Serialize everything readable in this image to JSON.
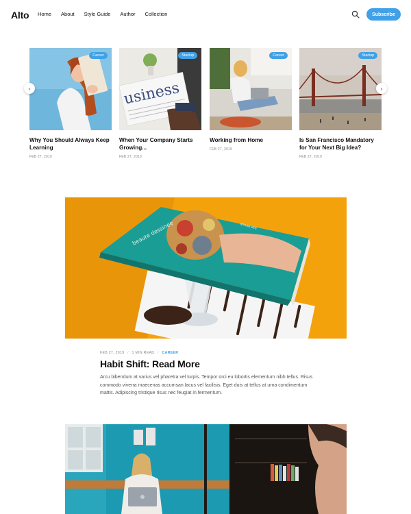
{
  "header": {
    "logo": "Alto",
    "nav": [
      "Home",
      "About",
      "Style Guide",
      "Author",
      "Collection"
    ],
    "search_icon": "search-icon",
    "subscribe_label": "Subscribe",
    "accent_color": "#3fa1e8"
  },
  "carousel": {
    "prev_icon": "chevron-left-icon",
    "next_icon": "chevron-right-icon",
    "cards": [
      {
        "tag": "Career",
        "title": "Why You Should Always Keep Learning",
        "date": "FEB 27, 2019"
      },
      {
        "tag": "Startup",
        "title": "When Your Company Starts Growing...",
        "date": "FEB 27, 2019"
      },
      {
        "tag": "Career",
        "title": "Working from Home",
        "date": "FEB 27, 2019"
      },
      {
        "tag": "Startup",
        "title": "Is San Francisco Mandatory for Your Next Big Idea?",
        "date": "FEB 27, 2019"
      }
    ]
  },
  "featured": {
    "date": "FEB 27, 2019",
    "read_time": "1 MIN READ",
    "category": "CAREER",
    "title": "Habit Shift: Read More",
    "excerpt": "Arcu bibendum at varius vel pharetra vel turpis. Tempor orci eu lobortis elementum nibh tellus. Risus commodo viverra maecenas accumsan lacus vel facilisis. Eget duis at tellus at urna condimentum mattis. Adipiscing tristique risus nec feugiat in fermentum."
  }
}
